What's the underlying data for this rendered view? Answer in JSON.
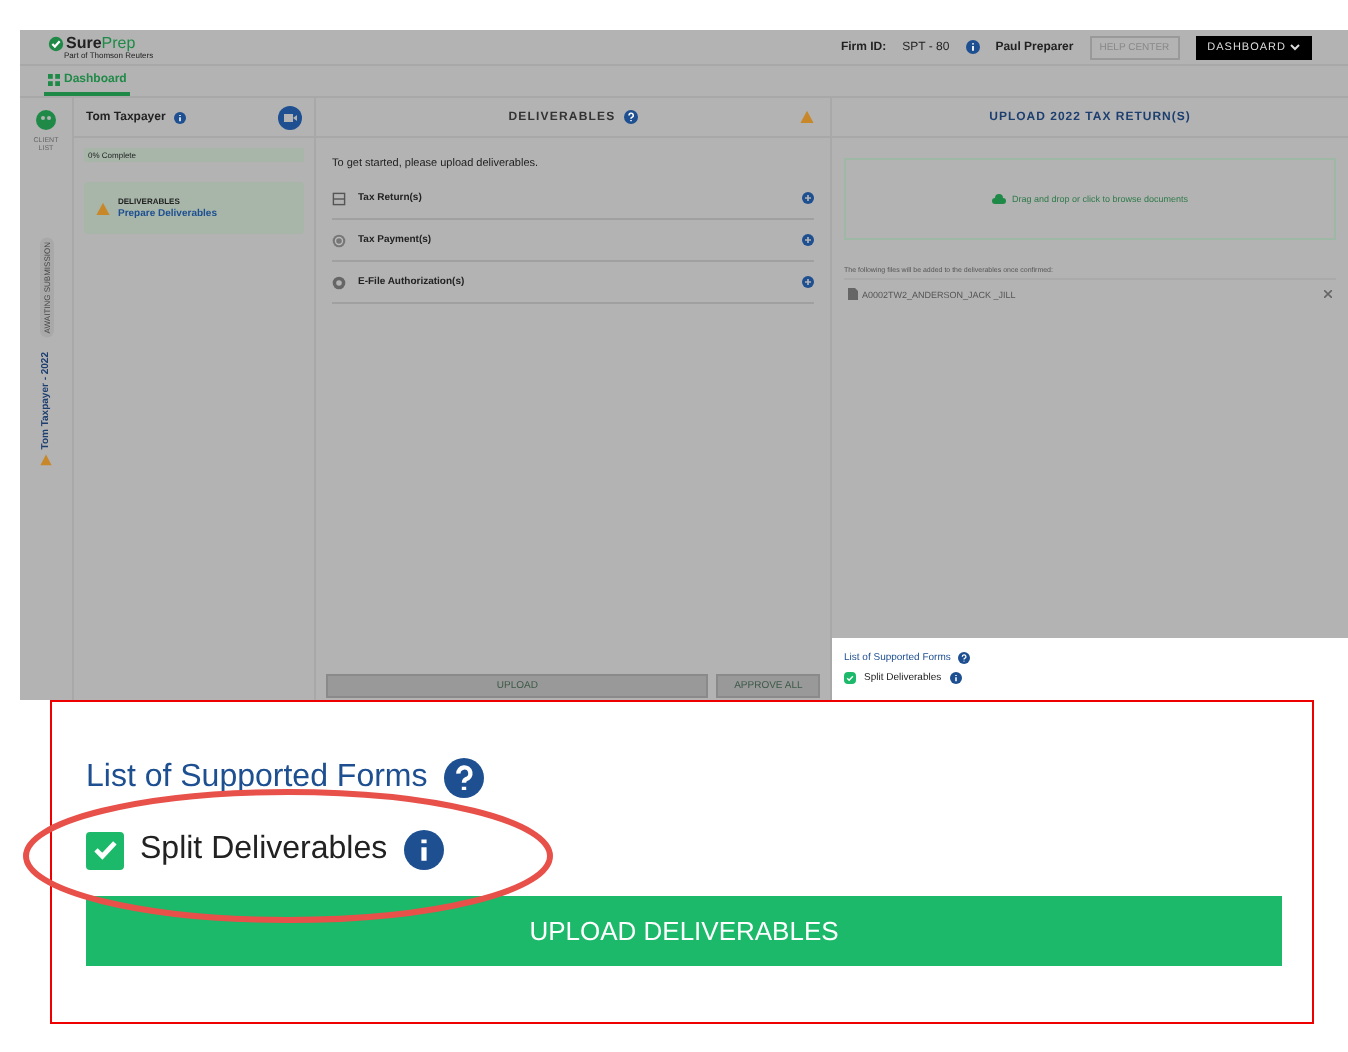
{
  "header": {
    "logo_primary": "Sure",
    "logo_secondary": "Prep",
    "logo_tagline": "Part of Thomson Reuters",
    "firm_label": "Firm ID:",
    "firm_id": "SPT - 80",
    "user": "Paul Preparer",
    "help_button": "HELP CENTER",
    "dashboard_button": "DASHBOARD"
  },
  "nav_tabs": [
    {
      "label": "Dashboard",
      "selected": true
    }
  ],
  "rail": {
    "client_list": "CLIENT LIST",
    "status_pill": "AWAITING SUBMISSION",
    "client_year": "Tom Taxpayer - 2022"
  },
  "client_panel": {
    "name": "Tom Taxpayer",
    "progress": "0% Complete",
    "level": 0,
    "task_title": "DELIVERABLES",
    "task_link": "Prepare Deliverables"
  },
  "deliverables": {
    "title": "DELIVERABLES",
    "intro": "To get started, please upload deliverables.",
    "items": [
      {
        "label": "Tax Return(s)",
        "kind": "return"
      },
      {
        "label": "Tax Payment(s)",
        "kind": "payment"
      },
      {
        "label": "E-File Authorization(s)",
        "kind": "efile"
      }
    ],
    "upload_button": "UPLOAD",
    "approve_button": "APPROVE ALL"
  },
  "upload_panel": {
    "title": "UPLOAD 2022 TAX RETURN(S)",
    "dropzone": "Drag and drop or click to browse documents",
    "files_note": "The following files will be added to the deliverables once confirmed:",
    "files": [
      "A0002TW2_ANDERSON_JACK _JILL"
    ]
  },
  "options": {
    "link": "List of Supported Forms",
    "split_label": "Split Deliverables",
    "split_checked": true
  },
  "callout": {
    "link": "List of Supported Forms",
    "split_label": "Split Deliverables",
    "split_checked": true,
    "upload_button": "UPLOAD DELIVERABLES"
  }
}
